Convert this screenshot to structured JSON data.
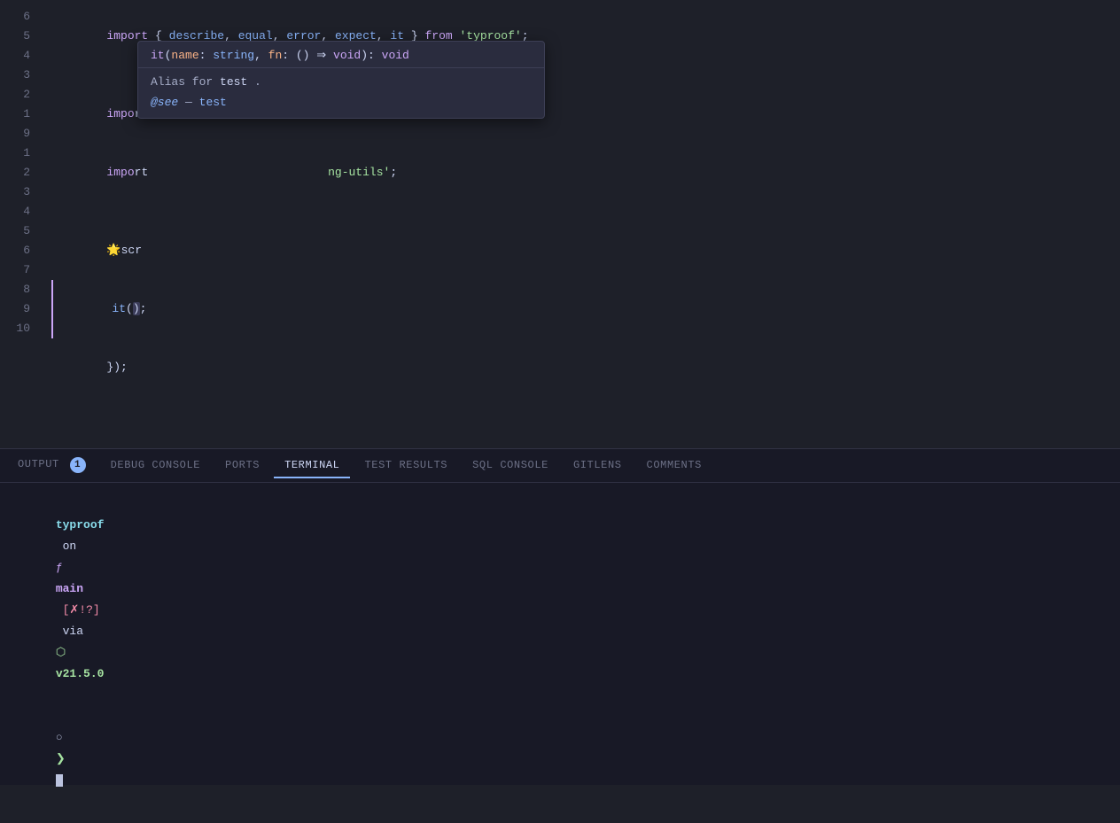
{
  "editor": {
    "lines": [
      {
        "num": "6",
        "content_html": "<span class='import-kw'>import</span> <span class='punc'>{ </span><span class='fn'>describe</span><span class='punc'>,</span> <span class='fn'>equal</span><span class='punc'>,</span> <span class='fn'>error</span><span class='punc'>,</span> <span class='fn'>expect</span><span class='punc'>,</span> <span class='fn'>it</span> <span class='punc'>}</span> <span class='import-kw'>from</span> <span class='str'>'typroof'</span><span class='punc'>;</span>"
      },
      {
        "num": "5",
        "content_html": ""
      },
      {
        "num": "4",
        "content_html": "<span class='import-kw'>impo</span><span class='var'>r</span><span class='fn'>t</span>"
      },
      {
        "num": "3",
        "content_html": "<span class='import-kw'>impo</span><span class='var'>r</span><span class='fn'>t</span>                            <span class='str'>ng-utils'</span><span class='punc'>;</span>"
      },
      {
        "num": "2",
        "content_html": ""
      },
      {
        "num": "1",
        "content_html": "<span class='emoji'>🌟</span><span class='var'>scr</span>"
      },
      {
        "num": "9",
        "active": true,
        "content_html": "<span class='fn'>it</span><span class='punc'>(</span><span class='highlight-paren'>)</span><span class='punc'>;</span>"
      },
      {
        "num": "1",
        "content_html": "<span class='punc'>});</span>"
      },
      {
        "num": "2",
        "content_html": ""
      },
      {
        "num": "3",
        "content_html": ""
      },
      {
        "num": "4",
        "content_html": ""
      },
      {
        "num": "5",
        "content_html": ""
      },
      {
        "num": "6",
        "content_html": ""
      },
      {
        "num": "7",
        "content_html": ""
      },
      {
        "num": "8",
        "content_html": ""
      },
      {
        "num": "9",
        "content_html": ""
      },
      {
        "num": "10",
        "content_html": ""
      }
    ]
  },
  "autocomplete": {
    "signature": "it(name: string, fn: () => void): void",
    "sig_parts": {
      "it": "it",
      "params": "name: string, fn: () => void",
      "return_type": "void"
    },
    "description": "Alias for",
    "code_ref": "test",
    "period": ".",
    "see_tag": "@see",
    "see_dash": "—",
    "see_link": "test"
  },
  "panel": {
    "tabs": [
      {
        "id": "output",
        "label": "OUTPUT",
        "active": false,
        "badge": "1"
      },
      {
        "id": "debug-console",
        "label": "DEBUG CONSOLE",
        "active": false,
        "badge": null
      },
      {
        "id": "ports",
        "label": "PORTS",
        "active": false,
        "badge": null
      },
      {
        "id": "terminal",
        "label": "TERMINAL",
        "active": true,
        "badge": null
      },
      {
        "id": "test-results",
        "label": "TEST RESULTS",
        "active": false,
        "badge": null
      },
      {
        "id": "sql-console",
        "label": "SQL CONSOLE",
        "active": false,
        "badge": null
      },
      {
        "id": "gitlens",
        "label": "GITLENS",
        "active": false,
        "badge": null
      },
      {
        "id": "comments",
        "label": "COMMENTS",
        "active": false,
        "badge": null
      }
    ]
  },
  "terminal": {
    "project": "typroof",
    "on_text": "on",
    "branch_icon": "ƒ",
    "branch_name": "main",
    "git_status": "[✗!?]",
    "via_text": "via",
    "node_icon": "⬡",
    "node_version": "v21.5.0",
    "prompt_symbol1": "❯",
    "prompt_symbol2": "❯"
  }
}
